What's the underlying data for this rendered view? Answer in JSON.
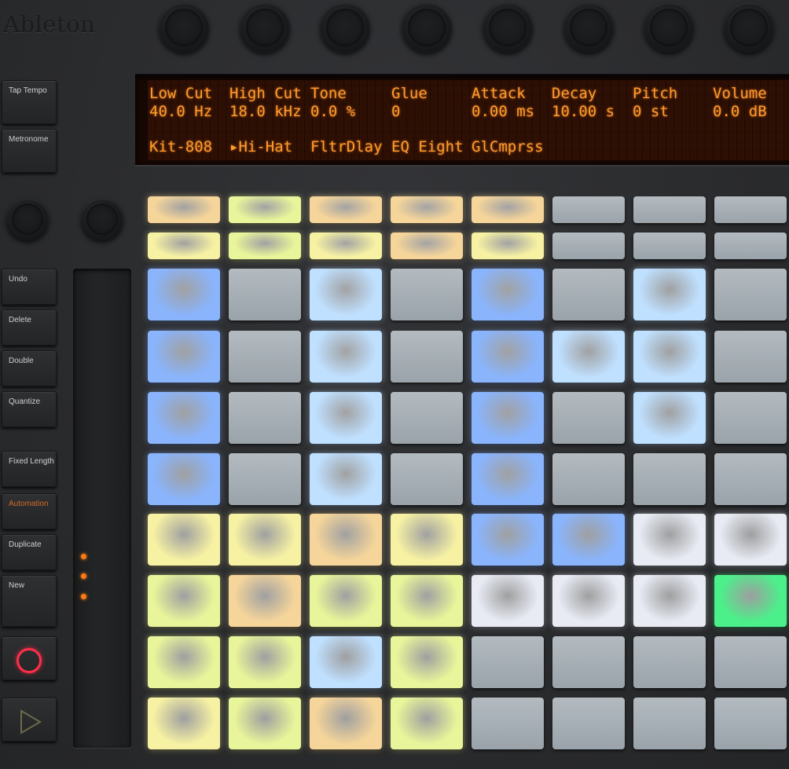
{
  "brand": "Ableton",
  "display": {
    "params": [
      {
        "name": "Low Cut",
        "value": "40.0 Hz"
      },
      {
        "name": "High Cut",
        "value": "18.0 kHz"
      },
      {
        "name": "Tone",
        "value": "0.0 %"
      },
      {
        "name": "Glue",
        "value": "0"
      },
      {
        "name": "Attack",
        "value": "0.00 ms"
      },
      {
        "name": "Decay",
        "value": "10.00 s"
      },
      {
        "name": "Pitch",
        "value": "0 st"
      },
      {
        "name": "Volume",
        "value": "0.0 dB"
      }
    ],
    "devices": [
      "Kit-808",
      "▸Hi-Hat",
      "FltrDlay",
      "EQ Eight",
      "GlCmprss",
      "",
      "",
      ""
    ]
  },
  "left_buttons": [
    {
      "label": "Tap Tempo",
      "id": "tap-tempo-button",
      "color": "light"
    },
    {
      "label": "Metronome",
      "id": "metronome-button",
      "color": "light"
    },
    {
      "label": "Undo",
      "id": "undo-button",
      "color": "light"
    },
    {
      "label": "Delete",
      "id": "delete-button",
      "color": "light"
    },
    {
      "label": "Double",
      "id": "double-button",
      "color": "light"
    },
    {
      "label": "Quantize",
      "id": "quantize-button",
      "color": "light"
    },
    {
      "label": "Fixed Length",
      "id": "fixed-length-button",
      "color": "light"
    },
    {
      "label": "Automation",
      "id": "automation-button",
      "color": "orange"
    },
    {
      "label": "Duplicate",
      "id": "duplicate-button",
      "color": "light"
    },
    {
      "label": "New",
      "id": "new-button",
      "color": "light"
    }
  ],
  "transport": {
    "record_icon": "record-icon",
    "play_icon": "play-icon"
  },
  "colors": {
    "yellow": "#f6f1a3",
    "amber": "#f5d59a",
    "lime": "#e9f59a",
    "blue": "#8ab4fb",
    "lightblue": "#bfe0ff",
    "grey": "#a9b2b8",
    "white": "#e8ebf4",
    "green": "#4cf08a",
    "orange_led": "#ff7a14"
  },
  "top_row1": [
    "amber",
    "lime",
    "amber",
    "amber",
    "amber",
    "grey",
    "grey",
    "grey"
  ],
  "top_row2": [
    "yellow",
    "lime",
    "yellow",
    "amber",
    "yellow",
    "grey",
    "grey",
    "grey"
  ],
  "pad_rows": [
    [
      "blue",
      "grey",
      "lightblue",
      "grey",
      "blue",
      "grey",
      "lightblue",
      "grey"
    ],
    [
      "blue",
      "grey",
      "lightblue",
      "grey",
      "blue",
      "lightblue",
      "lightblue",
      "grey"
    ],
    [
      "blue",
      "grey",
      "lightblue",
      "grey",
      "blue",
      "grey",
      "lightblue",
      "grey"
    ],
    [
      "blue",
      "grey",
      "lightblue",
      "grey",
      "blue",
      "grey",
      "grey",
      "grey"
    ],
    [
      "yellow",
      "yellow",
      "amber",
      "yellow",
      "blue",
      "blue",
      "white",
      "white"
    ],
    [
      "lime",
      "amber",
      "lime",
      "lime",
      "white",
      "white",
      "white",
      "green"
    ],
    [
      "lime",
      "lime",
      "lightblue",
      "lime",
      "grey",
      "grey",
      "grey",
      "grey"
    ],
    [
      "yellow",
      "lime",
      "amber",
      "lime",
      "grey",
      "grey",
      "grey",
      "grey"
    ]
  ]
}
